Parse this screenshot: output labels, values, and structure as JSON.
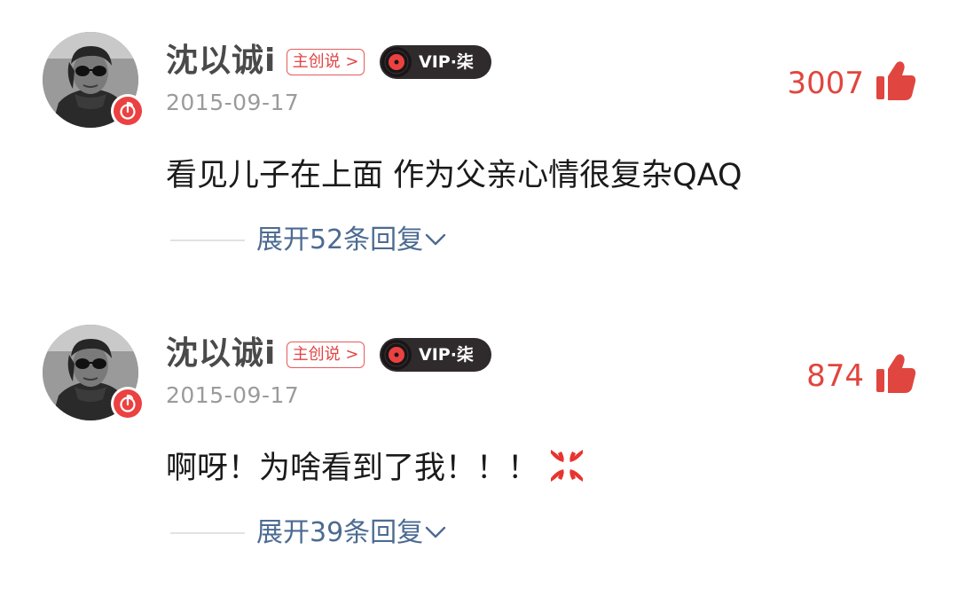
{
  "comments": [
    {
      "username": "沈以诚i",
      "creator_tag": "主创说 >",
      "vip_label": "VIP·柒",
      "date": "2015-09-17",
      "likes": "3007",
      "text": "看见儿子在上面 作为父亲心情很复杂QAQ",
      "emoji": "",
      "expand_label": "展开52条回复"
    },
    {
      "username": "沈以诚i",
      "creator_tag": "主创说 >",
      "vip_label": "VIP·柒",
      "date": "2015-09-17",
      "likes": "874",
      "text": "啊呀！为啥看到了我！！！",
      "emoji": "anger-symbol-icon",
      "expand_label": "展开39条回复"
    }
  ],
  "colors": {
    "username": "#4a4a4a",
    "like_red": "#e0463f",
    "link_blue": "#4c6b91",
    "vip_bg": "#2f2a2b",
    "badge_red": "#ec4141"
  },
  "icons": {
    "avatar_badge": "music-note-icon",
    "vip": "vinyl-disc-icon",
    "like": "thumbs-up-icon",
    "expand": "chevron-down-icon"
  }
}
